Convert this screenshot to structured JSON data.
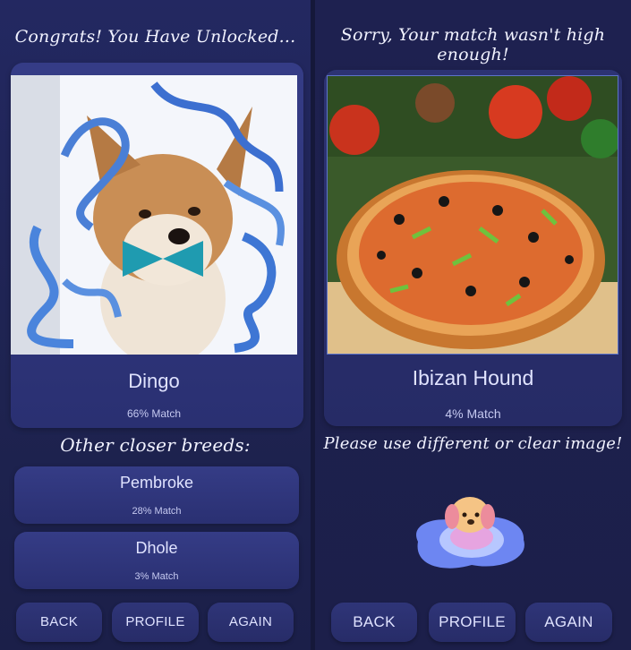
{
  "left": {
    "title": "Congrats! You Have Unlocked...",
    "result": {
      "breed": "Dingo",
      "match": "66% Match"
    },
    "other_heading": "Other closer breeds:",
    "others": [
      {
        "breed": "Pembroke",
        "match": "28% Match"
      },
      {
        "breed": "Dhole",
        "match": "3% Match"
      }
    ],
    "buttons": {
      "back": "BACK",
      "profile": "PROFILE",
      "again": "AGAIN"
    }
  },
  "right": {
    "title": "Sorry, Your match wasn't high enough!",
    "result": {
      "breed": "Ibizan Hound",
      "match": "4% Match"
    },
    "message": "Please use different or clear image!",
    "buttons": {
      "back": "BACK",
      "profile": "PROFILE",
      "again": "AGAIN"
    }
  },
  "icons": [
    "dog-photo",
    "pizza-photo",
    "dog-in-puddle-icon"
  ],
  "colors": {
    "background": "#1f2350",
    "card": "#353c86",
    "text": "#e0e3ff"
  }
}
